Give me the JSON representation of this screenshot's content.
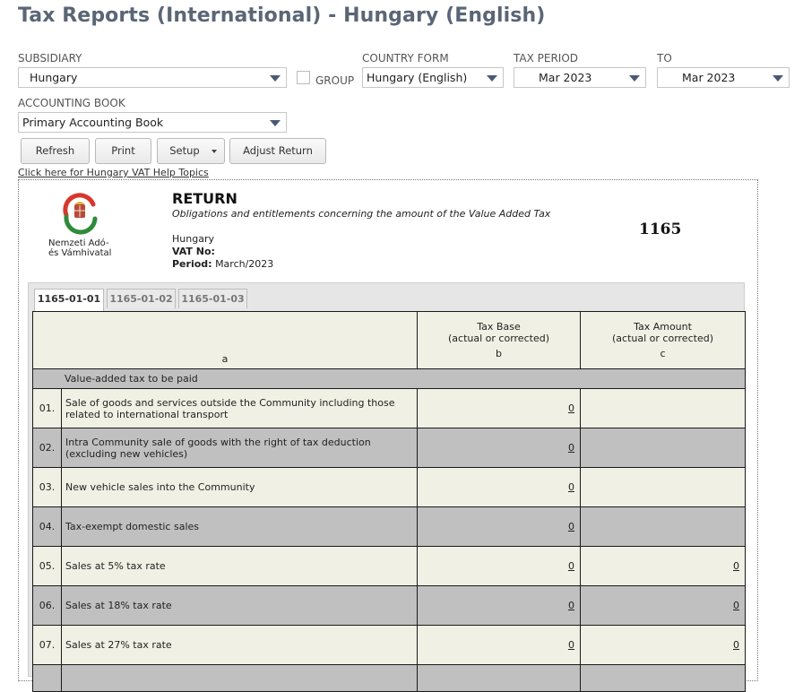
{
  "header": {
    "title": "Tax Reports (International) - Hungary (English)"
  },
  "filters": {
    "subsidiary": {
      "label": "SUBSIDIARY",
      "value": "Hungary"
    },
    "group": {
      "label": "GROUP",
      "checked": false
    },
    "country_form": {
      "label": "COUNTRY FORM",
      "value": "Hungary (English)"
    },
    "tax_period": {
      "label": "TAX PERIOD",
      "value": "Mar 2023"
    },
    "to": {
      "label": "TO",
      "value": "Mar 2023"
    },
    "accounting_book": {
      "label": "ACCOUNTING BOOK",
      "value": "Primary Accounting Book"
    }
  },
  "toolbar": {
    "refresh": "Refresh",
    "print": "Print",
    "setup": "Setup",
    "adjust": "Adjust Return"
  },
  "help_link": "Click here for Hungary VAT Help Topics",
  "report": {
    "logo_line1": "Nemzeti Adó-",
    "logo_line2": "és Vámhivatal",
    "title": "RETURN",
    "subtitle": "Obligations and entitlements concerning the amount of the Value Added Tax",
    "country": "Hungary",
    "vat_label": "VAT No:",
    "vat_value": "",
    "period_label": "Period:",
    "period_value": "March/2023",
    "form_number": "1165"
  },
  "tabs": [
    "1165-01-01",
    "1165-01-02",
    "1165-01-03"
  ],
  "active_tab": 0,
  "table": {
    "col_a": "a",
    "col_b_title1": "Tax Base",
    "col_b_title2": "(actual or corrected)",
    "col_b": "b",
    "col_c_title1": "Tax Amount",
    "col_c_title2": "(actual or corrected)",
    "col_c": "c",
    "section": "Value-added tax to be paid",
    "rows": [
      {
        "num": "01.",
        "desc": "Sale of goods and services outside the Community including those related to international transport",
        "base": "0",
        "amount": ""
      },
      {
        "num": "02.",
        "desc": "Intra Community sale of goods with the right of tax deduction (excluding new vehicles)",
        "base": "0",
        "amount": ""
      },
      {
        "num": "03.",
        "desc": "New vehicle sales into the Community",
        "base": "0",
        "amount": ""
      },
      {
        "num": "04.",
        "desc": "Tax-exempt domestic sales",
        "base": "0",
        "amount": ""
      },
      {
        "num": "05.",
        "desc": "Sales at 5% tax rate",
        "base": "0",
        "amount": "0"
      },
      {
        "num": "06.",
        "desc": "Sales at 18% tax rate",
        "base": "0",
        "amount": "0"
      },
      {
        "num": "07.",
        "desc": "Sales at 27% tax rate",
        "base": "0",
        "amount": "0"
      }
    ]
  }
}
